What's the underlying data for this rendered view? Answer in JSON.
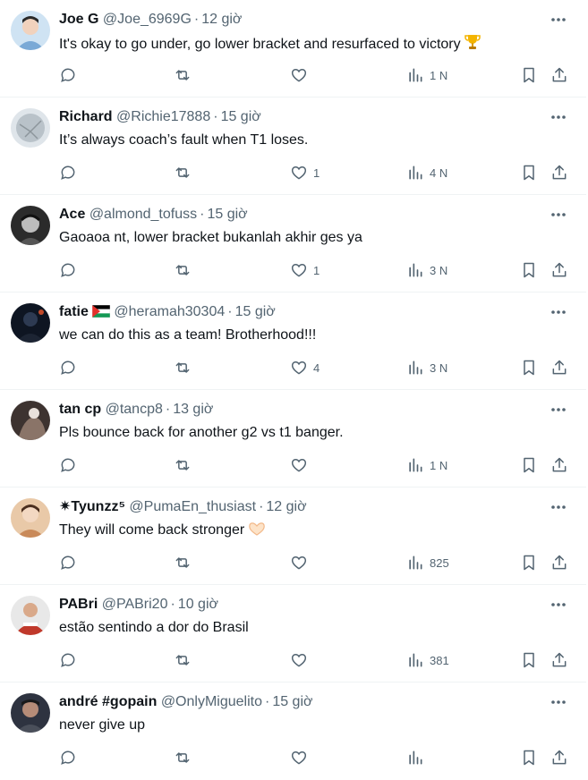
{
  "time_unit": "giờ",
  "tweets": [
    {
      "name": "Joe G",
      "handle": "@Joe_6969G",
      "time": "12 giờ",
      "text": "It's okay to go under, go lower bracket and resurfaced to victory",
      "emoji": "trophy-icon",
      "likes": "",
      "views": "1 N",
      "avatar_color": "#7aa9d6"
    },
    {
      "name": "Richard",
      "handle": "@Richie17888",
      "time": "15 giờ",
      "text": "It’s always coach’s fault when T1 loses.",
      "emoji": "",
      "likes": "1",
      "views": "4 N",
      "avatar_color": "#b9c2c9"
    },
    {
      "name": "Ace",
      "handle": "@almond_tofuss",
      "time": "15 giờ",
      "text": "Gaoaoa nt, lower bracket bukanlah akhir ges ya",
      "emoji": "",
      "likes": "1",
      "views": "3 N",
      "avatar_color": "#3a3a3a"
    },
    {
      "name": "fatie",
      "handle": "@heramah30304",
      "time": "15 giờ",
      "text": "we can do this as a team! Brotherhood!!!",
      "emoji": "",
      "likes": "4",
      "views": "3 N",
      "avatar_color": "#1c2433"
    },
    {
      "name": "tan cp",
      "handle": "@tancp8",
      "time": "13 giờ",
      "text": "Pls bounce back for another g2 vs t1 banger.",
      "emoji": "",
      "likes": "",
      "views": "1 N",
      "avatar_color": "#6b5a52"
    },
    {
      "name": "✷Tyunzz⁵",
      "handle": "@PumaEn_thusiast",
      "time": "12 giờ",
      "text": "They will come back stronger",
      "emoji": "heart-hands-icon",
      "likes": "",
      "views": "825",
      "avatar_color": "#c98a5a"
    },
    {
      "name": "PABri",
      "handle": "@PABri20",
      "time": "10 giờ",
      "text": "estão sentindo a dor do Brasil",
      "emoji": "",
      "likes": "",
      "views": "381",
      "avatar_color": "#c0392b"
    },
    {
      "name": "andré #gopain",
      "handle": "@OnlyMiguelito",
      "time": "15 giờ",
      "text": "never give up",
      "emoji": "",
      "likes": "",
      "views": "",
      "avatar_color": "#4a4f5a"
    }
  ]
}
